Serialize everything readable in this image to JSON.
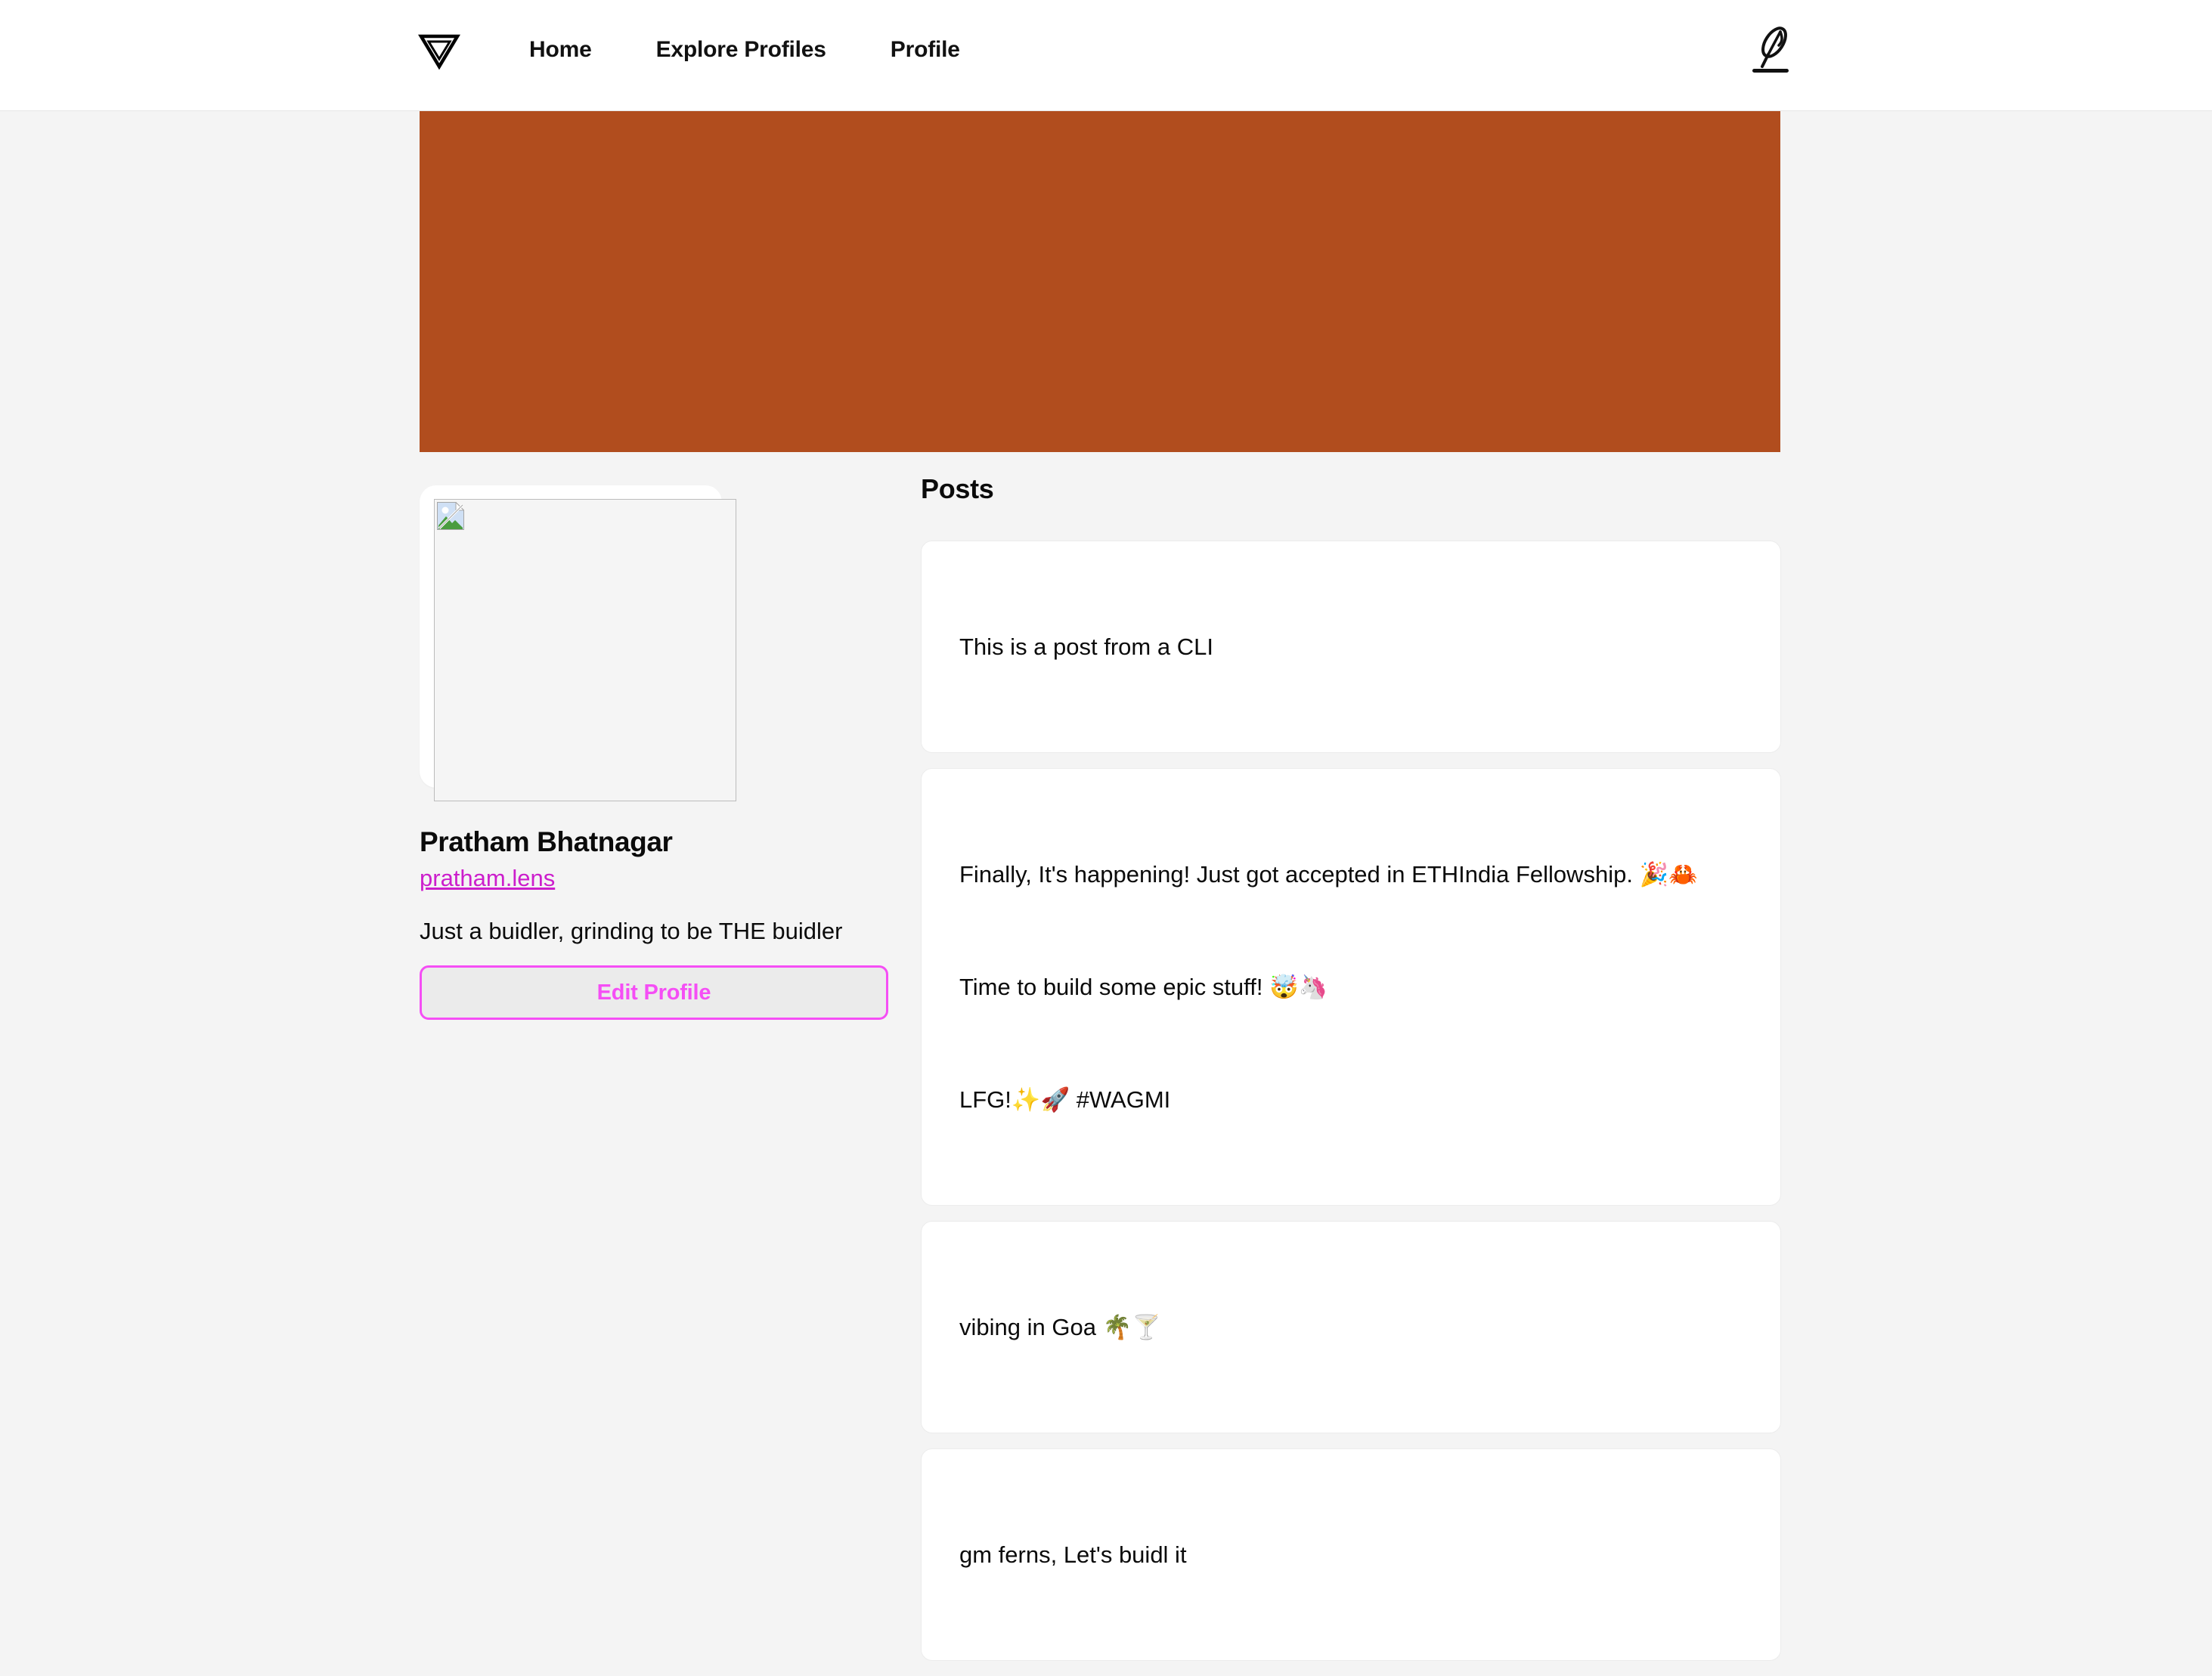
{
  "colors": {
    "page_bg": "#f4f4f4",
    "header_bg": "#ffffff",
    "banner": "#b14d1e",
    "accent_handle": "#cc1ecc",
    "accent_button": "#f54ef5",
    "card_bg": "#ffffff",
    "text": "#0b0b0b"
  },
  "header": {
    "logo_icon": "lens-triangle-logo",
    "nav": [
      {
        "label": "Home",
        "name": "nav-link-home"
      },
      {
        "label": "Explore Profiles",
        "name": "nav-link-explore-profiles"
      },
      {
        "label": "Profile",
        "name": "nav-link-profile"
      }
    ],
    "compose_icon": "quill-pen-icon"
  },
  "banner": {
    "alt": "profile-cover-banner"
  },
  "profile": {
    "avatar_icon": "broken-image-icon",
    "name": "Pratham Bhatnagar",
    "handle": "pratham.lens",
    "bio": "Just a buidler, grinding to be THE buidler",
    "edit_button_label": "Edit Profile"
  },
  "posts_section": {
    "title": "Posts",
    "posts": [
      {
        "lines": [
          "This is a post from a CLI"
        ]
      },
      {
        "lines": [
          "Finally, It's happening! Just got accepted in ETHIndia Fellowship. 🎉🦀",
          "Time to build some epic stuff! 🤯🦄",
          "LFG!✨🚀 #WAGMI"
        ]
      },
      {
        "lines": [
          "vibing in Goa 🌴🍸"
        ]
      },
      {
        "lines": [
          "gm ferns, Let's buidl it"
        ]
      }
    ]
  }
}
